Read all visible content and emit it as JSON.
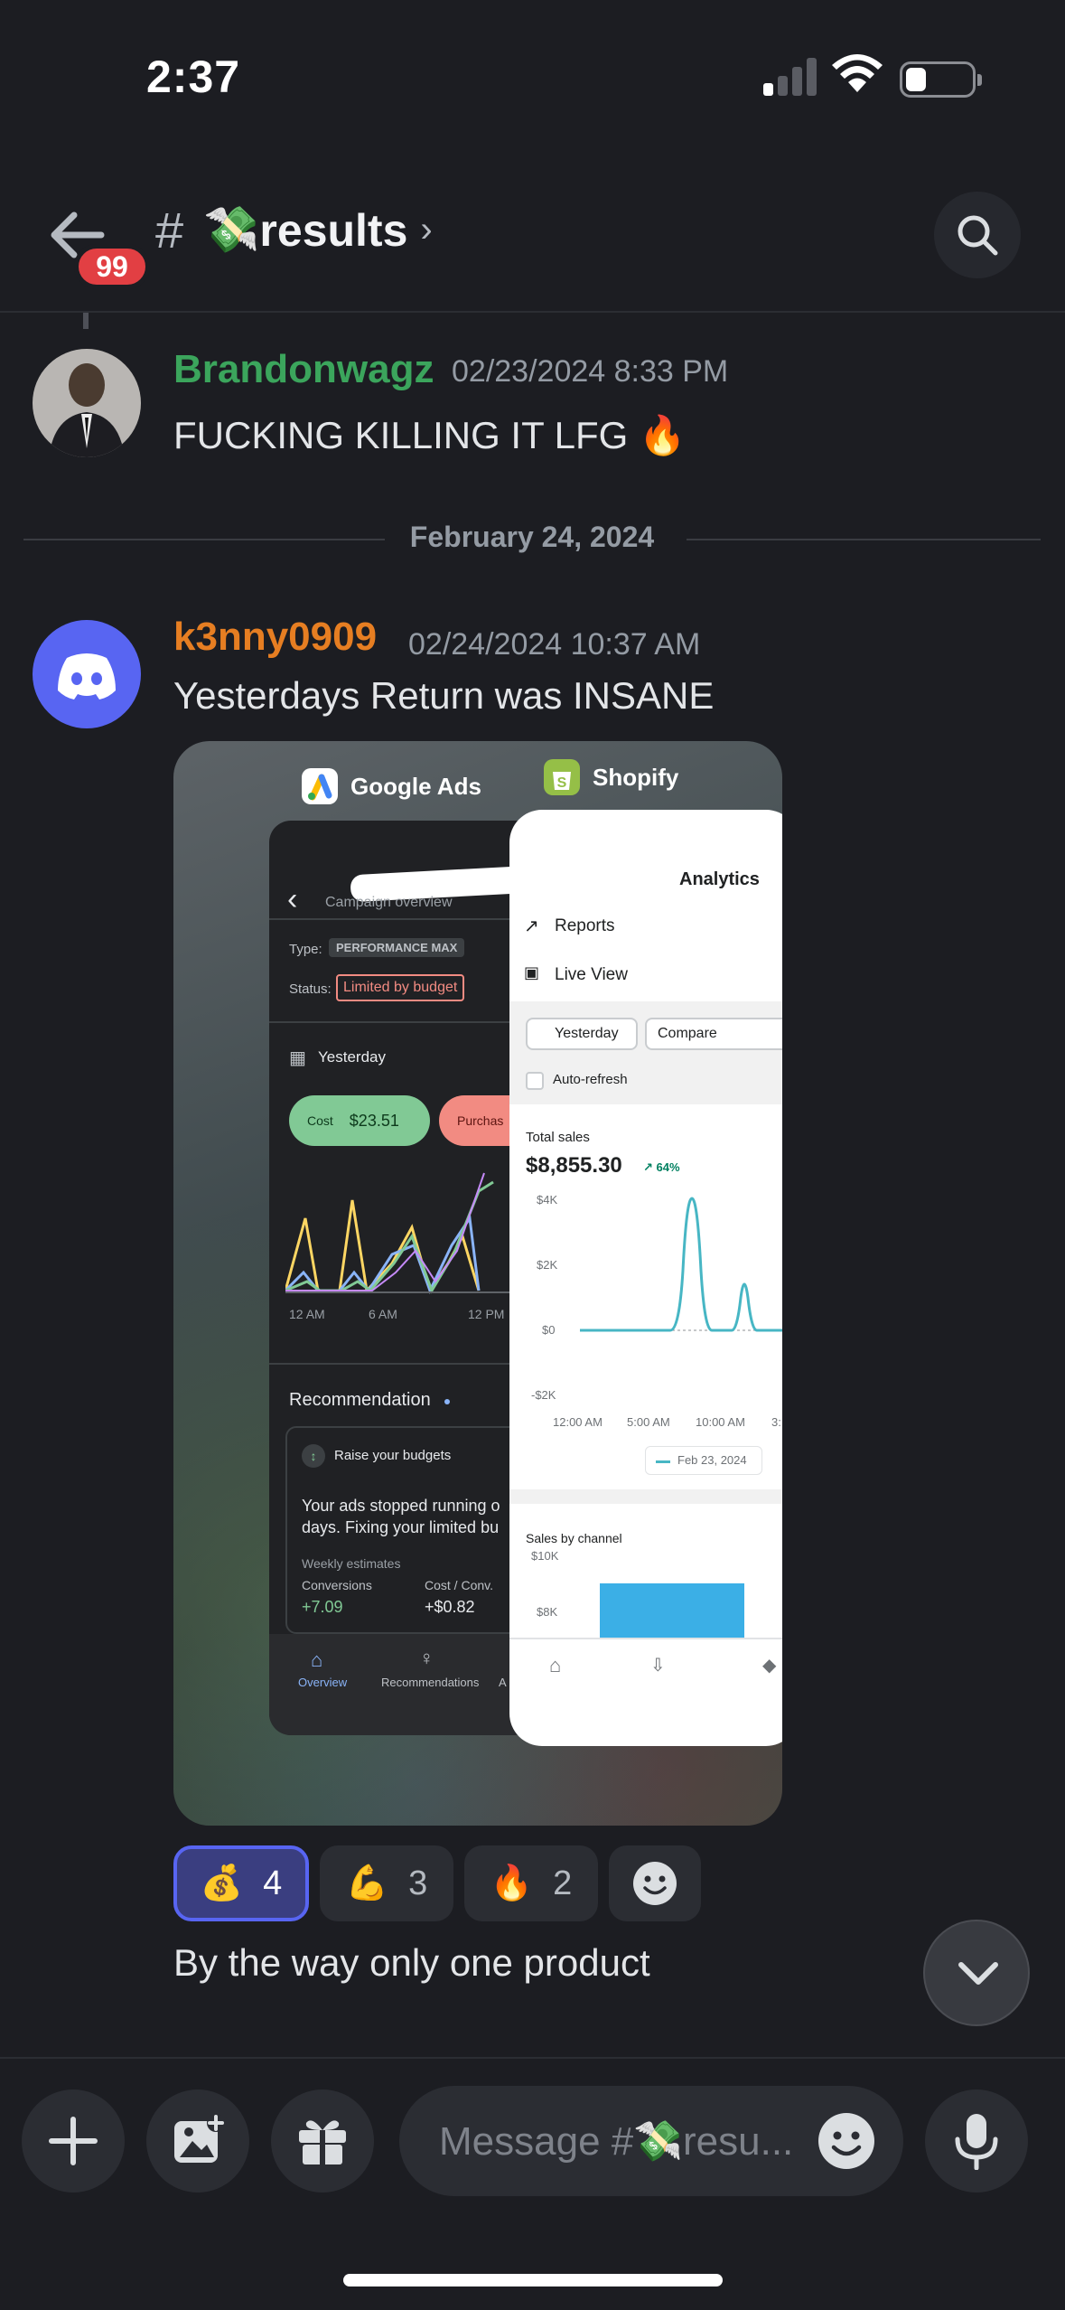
{
  "status_bar": {
    "time": "2:37",
    "battery_level": 0.25
  },
  "header": {
    "unread_count": "99",
    "channel_emoji": "💸",
    "channel_name": "results",
    "chevron": "›"
  },
  "messages": [
    {
      "username": "Brandonwagz",
      "username_color": "#3ba55c",
      "timestamp": "02/23/2024 8:33 PM",
      "text": "FUCKING KILLING IT LFG 🔥"
    },
    {
      "username": "k3nny0909",
      "username_color": "#e67e22",
      "timestamp": "02/24/2024 10:37 AM",
      "text": "Yesterdays Return was INSANE",
      "followup": "By the way only one product"
    }
  ],
  "date_separator": "February 24, 2024",
  "attachment": {
    "google_ads": {
      "app_name": "Google Ads",
      "header": "Campaign overview",
      "type_label": "Type:",
      "type_value": "PERFORMANCE MAX",
      "status_label": "Status:",
      "status_value": "Limited by budget",
      "date_range": "Yesterday",
      "cost_label": "Cost",
      "cost_value": "$23.51",
      "purchase_label": "Purchas",
      "x_ticks": [
        "12 AM",
        "6 AM",
        "12 PM"
      ],
      "recommendation_title": "Recommendation",
      "rec_card_title": "Raise your budgets",
      "rec_card_text_1": "Your ads stopped running o",
      "rec_card_text_2": "days. Fixing your limited bu",
      "weekly_label": "Weekly estimates",
      "conversions_label": "Conversions",
      "conversions_value": "+7.09",
      "cost_conv_label": "Cost / Conv.",
      "cost_conv_value": "+$0.82",
      "nav": [
        "Overview",
        "Recommendations",
        "A"
      ]
    },
    "shopify": {
      "app_name": "Shopify",
      "title": "Analytics",
      "menu": [
        "Reports",
        "Live View"
      ],
      "date_button": "Yesterday",
      "compare_button": "Compare",
      "auto_refresh": "Auto-refresh",
      "total_sales_label": "Total sales",
      "total_sales_value": "$8,855.30",
      "change": "↗ 64%",
      "y_ticks": [
        "$4K",
        "$2K",
        "$0",
        "-$2K"
      ],
      "x_ticks": [
        "12:00 AM",
        "5:00 AM",
        "10:00 AM",
        "3:"
      ],
      "legend": "Feb 23, 2024",
      "channel_title": "Sales by channel",
      "channel_ticks": [
        "$10K",
        "$8K"
      ]
    }
  },
  "reactions": [
    {
      "emoji": "💰",
      "count": "4",
      "active": true
    },
    {
      "emoji": "💪",
      "count": "3",
      "active": false
    },
    {
      "emoji": "🔥",
      "count": "2",
      "active": false
    }
  ],
  "composer": {
    "placeholder": "Message #💸resu..."
  }
}
